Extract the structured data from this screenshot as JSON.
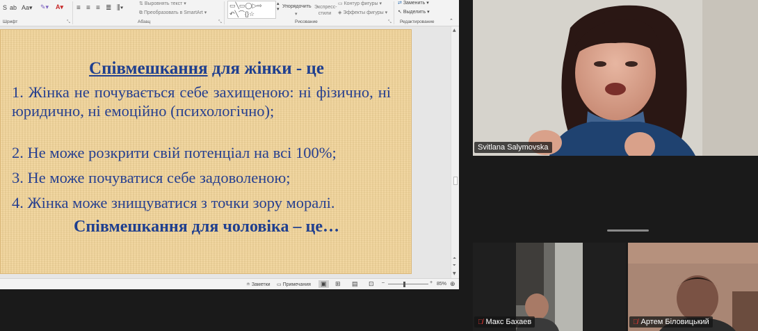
{
  "ribbon": {
    "font_group_label": "Шрифт",
    "paragraph_group_label": "Абзац",
    "drawing_group_label": "Рисование",
    "editing_group_label": "Редактирование",
    "text_direction": "Выровнять текст",
    "smartart": "Преобразовать в SmartArt",
    "arrange": "Упорядочить",
    "quick_styles": "Экспресс-стили",
    "shape_outline": "Контур фигуры",
    "shape_effects": "Эффекты фигуры",
    "replace": "Заменить",
    "select": "Выделить"
  },
  "slide": {
    "heading_underlined": "Співмешкання",
    "heading_rest": " для жінки - це",
    "item1": "1. Жінка не почувається себе захищеною: ні фізично, ні юридично, ні емоційно (психологічно);",
    "item2": "2. Не може розкрити свій потенціал на всі 100%;",
    "item3": "3. Не може почуватися себе задоволеною;",
    "item4": "4. Жінка може знищуватися з точки зору моралі.",
    "heading2": "Співмешкання для чоловіка – це…"
  },
  "statusbar": {
    "notes": "Заметки",
    "comments": "Примечания",
    "zoom": "85%"
  },
  "participants": {
    "speaker": "Svitlana Salymovska",
    "p2": "Макс Бахаев",
    "p3": "Артем Біловицький"
  },
  "colors": {
    "slide_text": "#263f8f",
    "slide_bg": "#f2d59a",
    "muted": "#e53935"
  }
}
